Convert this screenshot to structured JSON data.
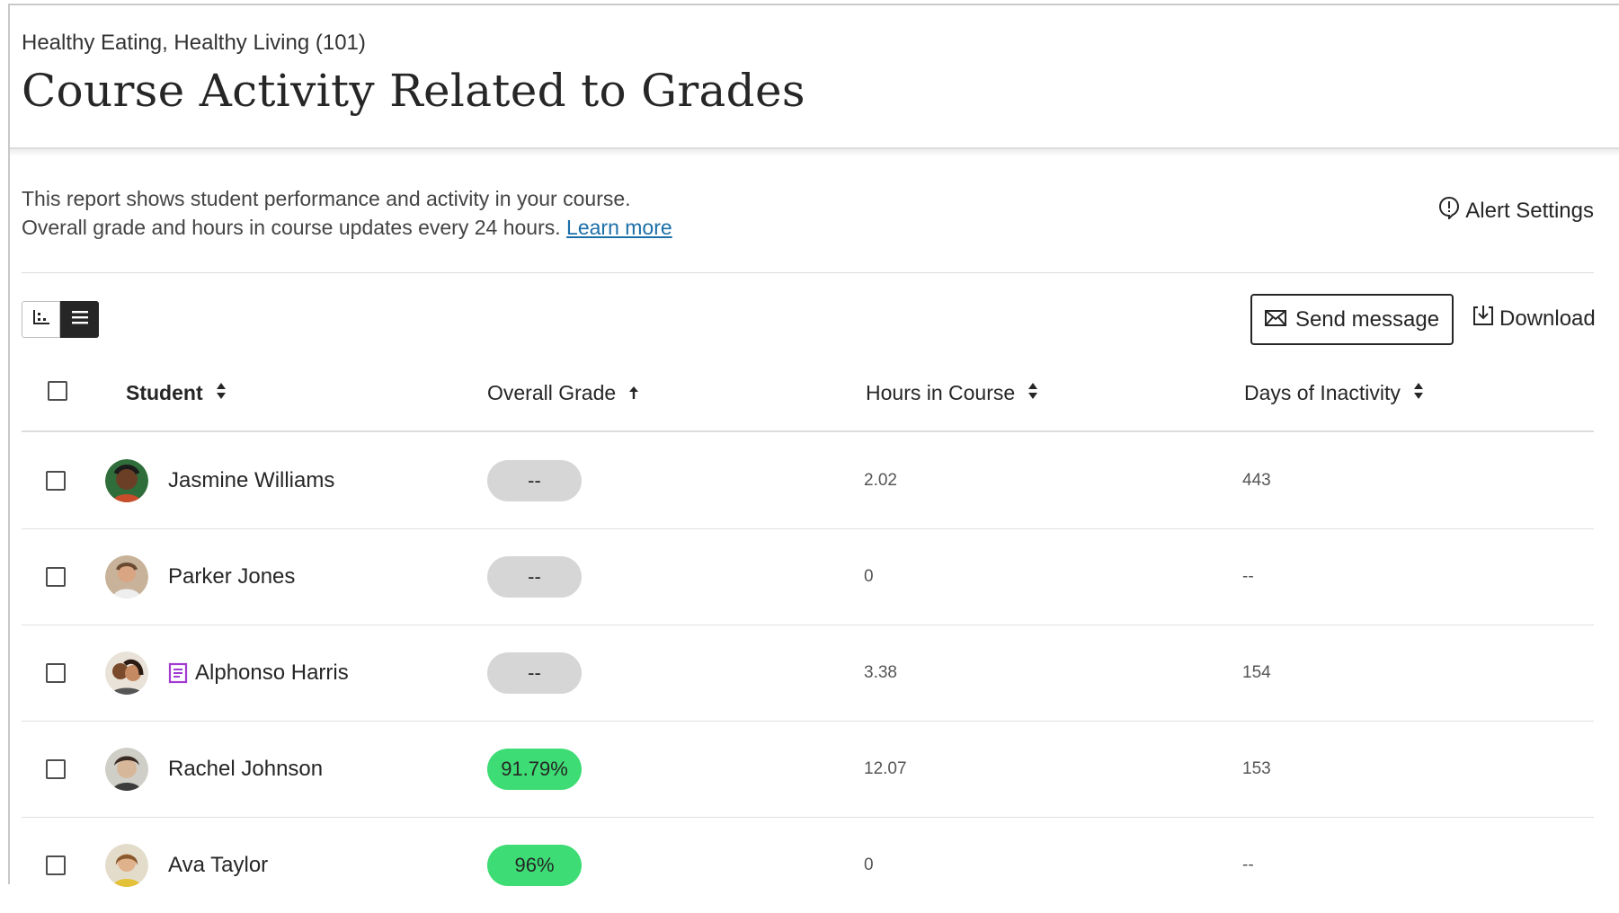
{
  "header": {
    "course_name": "Healthy Eating, Healthy Living (101)",
    "title": "Course Activity Related to Grades"
  },
  "description": {
    "line1": "This report shows student performance and activity in your course.",
    "line2": "Overall grade and hours in course updates every 24 hours.",
    "link": "Learn more"
  },
  "alert_settings": {
    "label": "Alert Settings",
    "icon": "alert-icon"
  },
  "toolbar": {
    "send_message": "Send message",
    "download": "Download"
  },
  "columns": {
    "student": "Student",
    "overall_grade": "Overall Grade",
    "hours": "Hours in Course",
    "inactivity": "Days of Inactivity"
  },
  "rows": [
    {
      "name": "Jasmine Williams",
      "grade": "--",
      "hours": "2.02",
      "inactivity": "443",
      "has_note": false
    },
    {
      "name": "Parker Jones",
      "grade": "--",
      "hours": "0",
      "inactivity": "--",
      "has_note": false
    },
    {
      "name": "Alphonso Harris",
      "grade": "--",
      "hours": "3.38",
      "inactivity": "154",
      "has_note": true
    },
    {
      "name": "Rachel Johnson",
      "grade": "91.79%",
      "hours": "12.07",
      "inactivity": "153",
      "has_note": false
    },
    {
      "name": "Ava Taylor",
      "grade": "96%",
      "hours": "0",
      "inactivity": "--",
      "has_note": false
    }
  ],
  "colors": {
    "grade_empty": "#d6d6d6",
    "grade_good": "#3ddc74",
    "note_icon": "#a23bd1",
    "link": "#1b6fa8"
  }
}
